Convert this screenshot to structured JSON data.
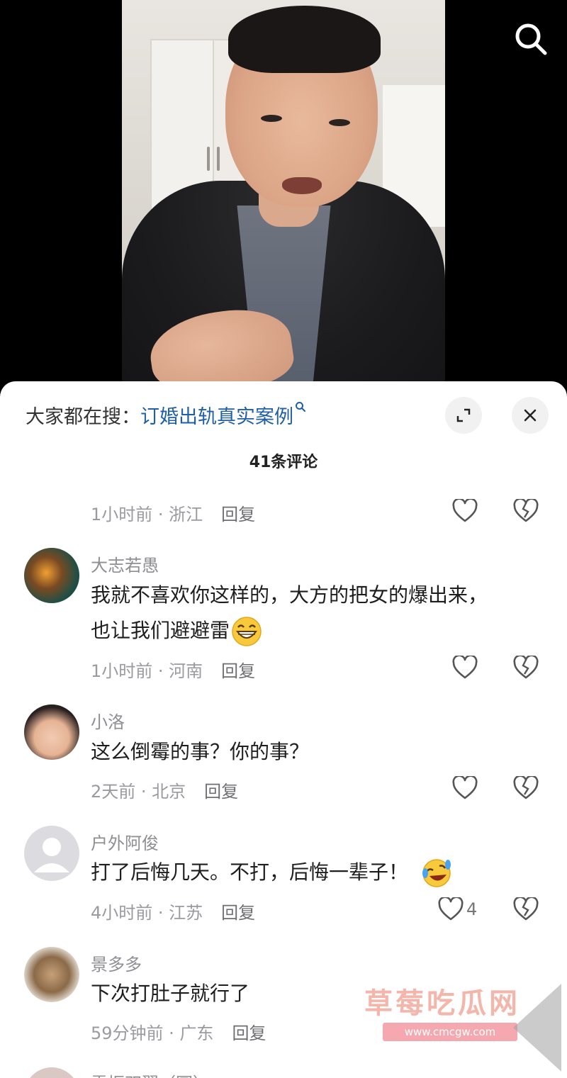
{
  "search_hint": {
    "prefix": "大家都在搜：",
    "keyword": "订婚出轨真实案例"
  },
  "sheet": {
    "title": "41条评论"
  },
  "comments": [
    {
      "time": "1小时前",
      "location": "浙江",
      "reply": "回复"
    },
    {
      "user": "大志若愚",
      "line1": "我就不喜欢你这样的，大方的把女的爆出来，",
      "line2": "也让我们避避雷",
      "emoji": "grin-emoji",
      "time": "1小时前",
      "location": "河南",
      "reply": "回复"
    },
    {
      "user": "小洛",
      "line1": "这么倒霉的事？你的事？",
      "time": "2天前",
      "location": "北京",
      "reply": "回复"
    },
    {
      "user": "户外阿俊",
      "line1": "打了后悔几天。不打，后悔一辈子！",
      "emoji": "rofl-emoji",
      "time": "4小时前",
      "location": "江苏",
      "reply": "回复",
      "like_count": "4"
    },
    {
      "user": "景多多",
      "line1": "下次打肚子就行了",
      "time": "59分钟前",
      "location": "广东",
      "reply": "回复"
    },
    {
      "user": "雪振双翼（圆）"
    }
  ],
  "watermark": {
    "text": "草莓吃瓜网",
    "url": "www.cmcgw.com"
  },
  "icons": {
    "search": "search-icon",
    "expand": "expand-icon",
    "close": "close-icon",
    "like": "heart-outline-icon",
    "dislike": "broken-heart-icon"
  },
  "colors": {
    "keyword": "#1f5fa8",
    "muted": "#9a9aa0",
    "text": "#1e1e1e"
  }
}
